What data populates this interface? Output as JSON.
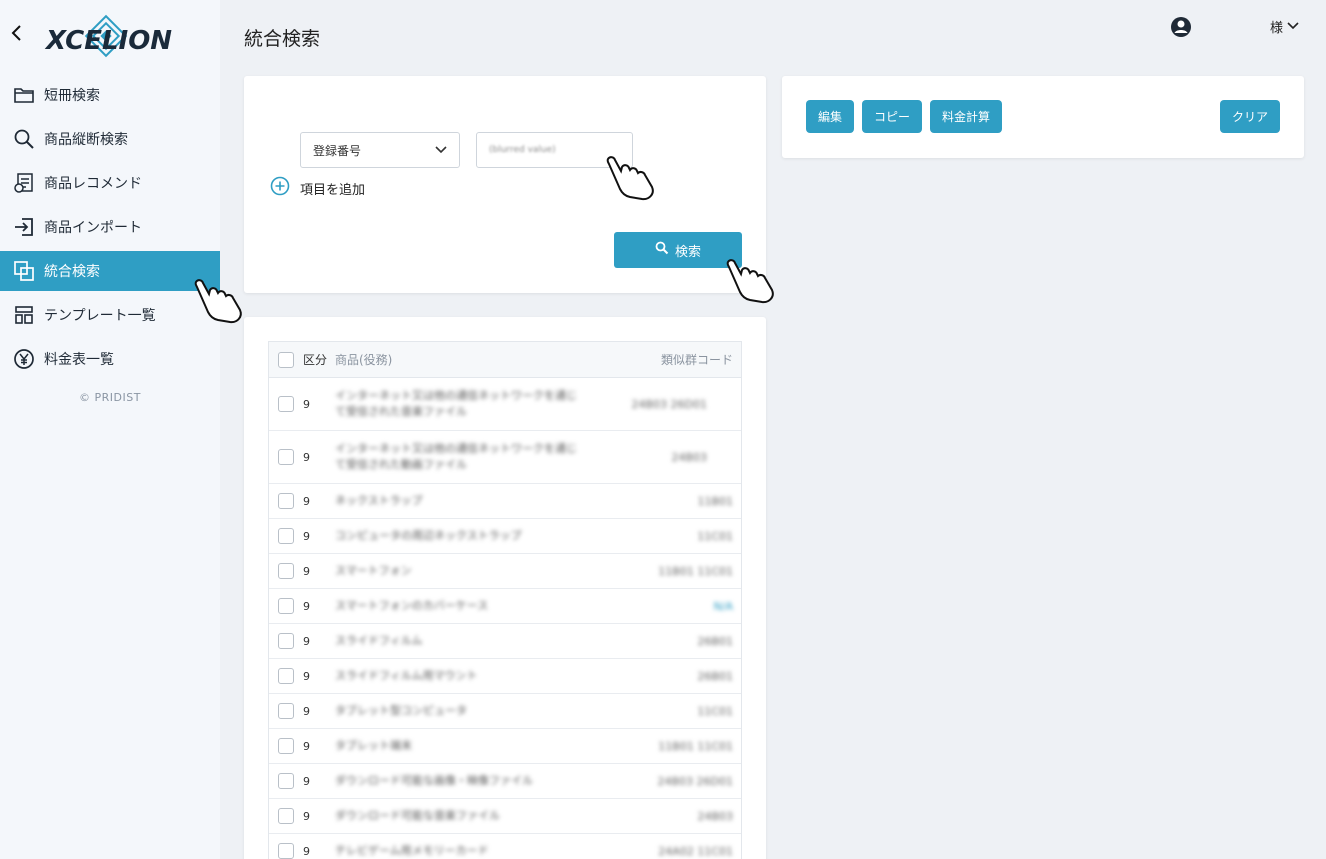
{
  "brand": "XCELION",
  "sidebar": {
    "items": [
      {
        "label": "短冊検索",
        "icon": "folder-icon"
      },
      {
        "label": "商品縦断検索",
        "icon": "search-icon"
      },
      {
        "label": "商品レコメンド",
        "icon": "recommend-icon"
      },
      {
        "label": "商品インポート",
        "icon": "import-icon"
      },
      {
        "label": "統合検索",
        "icon": "integrated-search-icon",
        "active": true
      },
      {
        "label": "テンプレート一覧",
        "icon": "template-icon"
      },
      {
        "label": "料金表一覧",
        "icon": "yen-icon"
      }
    ],
    "copyright": "© PRIDIST"
  },
  "header": {
    "title": "統合検索",
    "user_suffix": "様"
  },
  "search": {
    "field_select": "登録番号",
    "field_value": "(blurred value)",
    "add_item": "項目を追加",
    "search_button": "検索"
  },
  "actions": {
    "edit": "編集",
    "copy": "コピー",
    "calc": "料金計算",
    "clear": "クリア"
  },
  "table": {
    "headers": {
      "division": "区分",
      "product": "商品(役務)",
      "code": "類似群コード"
    },
    "rows": [
      {
        "division": "9",
        "product": "インターネット又は他の通信ネットワークを通じて受信された音楽ファイル",
        "code": "24B03 26D01"
      },
      {
        "division": "9",
        "product": "インターネット又は他の通信ネットワークを通じて受信された動画ファイル",
        "code": "24B03"
      },
      {
        "division": "9",
        "product": "ネックストラップ",
        "code": "11B01"
      },
      {
        "division": "9",
        "product": "コンピュータの周辺ネックストラップ",
        "code": "11C01"
      },
      {
        "division": "9",
        "product": "スマートフォン",
        "code": "11B01 11C01"
      },
      {
        "division": "9",
        "product": "スマートフォンのカバーケース",
        "code": "N/A"
      },
      {
        "division": "9",
        "product": "スライドフィルム",
        "code": "26B01"
      },
      {
        "division": "9",
        "product": "スライドフィルム用マウント",
        "code": "26B01"
      },
      {
        "division": "9",
        "product": "タブレット型コンピュータ",
        "code": "11C01"
      },
      {
        "division": "9",
        "product": "タブレット端末",
        "code": "11B01 11C01"
      },
      {
        "division": "9",
        "product": "ダウンロード可能な画像・映像ファイル",
        "code": "24B03 26D01"
      },
      {
        "division": "9",
        "product": "ダウンロード可能な音楽ファイル",
        "code": "24B03"
      },
      {
        "division": "9",
        "product": "テレビゲーム用メモリーカード",
        "code": "24A02 11C01"
      }
    ]
  },
  "colors": {
    "accent": "#2f9ec4",
    "background": "#eef1f5",
    "sidebar": "#f4f7fb"
  }
}
